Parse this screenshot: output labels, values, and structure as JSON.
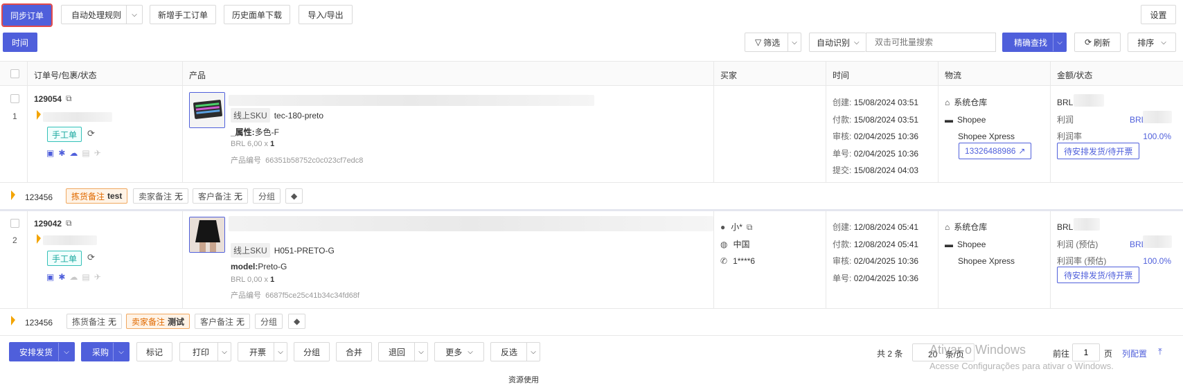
{
  "toolbar": {
    "sync": "同步订单",
    "auto_rules": "自动处理规则",
    "new_manual": "新增手工订单",
    "history_download": "历史面单下载",
    "import_export": "导入/导出",
    "settings": "设置"
  },
  "filter_bar": {
    "time": "时间",
    "filter": "筛选",
    "auto_detect": "自动识别",
    "search_placeholder": "双击可批量搜索",
    "precise_search": "精确查找",
    "refresh": "刷新",
    "sort": "排序"
  },
  "columns": [
    "订单号/包裹/状态",
    "产品",
    "买家",
    "时间",
    "物流",
    "金额/状态"
  ],
  "orders": [
    {
      "index": "1",
      "order_no": "129054",
      "manual_tag": "手工单",
      "sku_label": "线上SKU",
      "sku": "tec-180-preto",
      "attr_label": "_属性:",
      "attr_value": "多色-F",
      "price": "BRL 6,00 x",
      "qty": "1",
      "product_no_label": "产品编号",
      "product_no": "66351b58752c0c023cf7edc8",
      "buyer": {
        "name": "",
        "country": "",
        "phone": ""
      },
      "times": [
        {
          "label": "创建:",
          "value": "15/08/2024 03:51"
        },
        {
          "label": "付款:",
          "value": "15/08/2024 03:51"
        },
        {
          "label": "审核:",
          "value": "02/04/2025 10:36"
        },
        {
          "label": "单号:",
          "value": "02/04/2025 10:36"
        },
        {
          "label": "提交:",
          "value": "15/08/2024 04:03"
        }
      ],
      "warehouse": "系统仓库",
      "carrier": "Shopee",
      "service": "Shopee Xpress",
      "tracking": "13326488986",
      "amount_currency": "BRL",
      "profit_label": "利润",
      "profit_currency": "BRL",
      "margin_label": "利润率",
      "margin": "100.0%",
      "status": "待安排发货/待开票",
      "footer": {
        "id": "123456",
        "pick_note_label": "拣货备注",
        "pick_note": "test",
        "seller_note_label": "卖家备注",
        "seller_note": "无",
        "customer_note_label": "客户备注",
        "customer_note": "无",
        "group": "分组"
      }
    },
    {
      "index": "2",
      "order_no": "129042",
      "manual_tag": "手工单",
      "sku_label": "线上SKU",
      "sku": "H051-PRETO-G",
      "attr_label": "model:",
      "attr_value": "Preto-G",
      "price": "BRL 0,00 x",
      "qty": "1",
      "product_no_label": "产品编号",
      "product_no": "6687f5ce25c41b34c34fd68f",
      "buyer": {
        "name": "小*",
        "country": "中国",
        "phone": "1****6"
      },
      "times": [
        {
          "label": "创建:",
          "value": "12/08/2024 05:41"
        },
        {
          "label": "付款:",
          "value": "12/08/2024 05:41"
        },
        {
          "label": "审核:",
          "value": "02/04/2025 10:36"
        },
        {
          "label": "单号:",
          "value": "02/04/2025 10:36"
        }
      ],
      "warehouse": "系统仓库",
      "carrier": "Shopee",
      "service": "Shopee Xpress",
      "amount_currency": "BRL",
      "profit_label": "利润 (预估)",
      "profit_currency": "BRL",
      "margin_label": "利润率 (预估)",
      "margin": "100.0%",
      "status": "待安排发货/待开票",
      "footer": {
        "id": "123456",
        "pick_note_label": "拣货备注",
        "pick_note": "无",
        "seller_note_label": "卖家备注",
        "seller_note": "测试",
        "customer_note_label": "客户备注",
        "customer_note": "无",
        "group": "分组"
      }
    }
  ],
  "bottom": {
    "arrange_ship": "安排发货",
    "purchase": "采购",
    "mark": "标记",
    "print": "打印",
    "invoice": "开票",
    "group": "分组",
    "merge": "合并",
    "return": "退回",
    "more": "更多",
    "invert": "反选",
    "total": "共 2 条",
    "page_size": "20",
    "per_page": "条/页",
    "goto": "前往",
    "page": "1",
    "page_unit": "页",
    "column_config": "列配置"
  },
  "watermark": {
    "line1": "Ativar o Windows",
    "line2": "Acesse Configurações para ativar o Windows."
  },
  "bottom_cut_text": "资源使用"
}
